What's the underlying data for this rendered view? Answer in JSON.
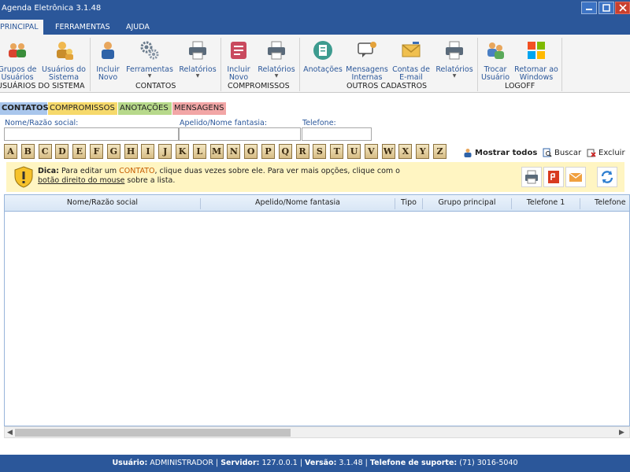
{
  "window": {
    "title": "Agenda Eletrônica 3.1.48"
  },
  "menu": {
    "tabs": [
      "PRINCIPAL",
      "FERRAMENTAS",
      "AJUDA"
    ]
  },
  "ribbon": {
    "sistema": {
      "grupos_l1": "Grupos de",
      "grupos_l2": "Usuários",
      "usuarios_l1": "Usuários do",
      "usuarios_l2": "Sistema",
      "label": "USUÁRIOS DO SISTEMA"
    },
    "contatos": {
      "incluir_l1": "Incluir",
      "incluir_l2": "Novo",
      "ferramentas": "Ferramentas",
      "relatorios": "Relatórios",
      "label": "CONTATOS"
    },
    "compromissos": {
      "incluir_l1": "Incluir",
      "incluir_l2": "Novo",
      "relatorios": "Relatórios",
      "label": "COMPROMISSOS"
    },
    "outros": {
      "anotacoes": "Anotações",
      "mensagens_l1": "Mensagens",
      "mensagens_l2": "Internas",
      "contas_l1": "Contas de",
      "contas_l2": "E-mail",
      "relatorios": "Relatórios",
      "label": "OUTROS CADASTROS"
    },
    "logoff": {
      "trocar_l1": "Trocar",
      "trocar_l2": "Usuário",
      "retornar_l1": "Retornar ao",
      "retornar_l2": "Windows",
      "label": "LOGOFF"
    }
  },
  "subtabs": [
    {
      "label": "CONTATOS",
      "color": "#a9c6ec"
    },
    {
      "label": "COMPROMISSOS",
      "color": "#f6d96b"
    },
    {
      "label": "ANOTAÇÕES",
      "color": "#b7d98b"
    },
    {
      "label": "MENSAGENS",
      "color": "#f2a6a6"
    }
  ],
  "filters": {
    "nome_label": "Nome/Razão social:",
    "nome_value": "",
    "apelido_label": "Apelido/Nome fantasia:",
    "apelido_value": "",
    "telefone_label": "Telefone:",
    "telefone_value": ""
  },
  "letters": [
    "A",
    "B",
    "C",
    "D",
    "E",
    "F",
    "G",
    "H",
    "I",
    "J",
    "K",
    "L",
    "M",
    "N",
    "O",
    "P",
    "Q",
    "R",
    "S",
    "T",
    "U",
    "V",
    "W",
    "X",
    "Y",
    "Z"
  ],
  "actions": {
    "mostrar_todos": "Mostrar todos",
    "buscar": "Buscar",
    "excluir": "Excluir"
  },
  "tip": {
    "dica": "Dica:",
    "part1": " Para editar um ",
    "contato": "CONTATO",
    "part2": ", clique duas vezes sobre ele. Para ver mais opções, clique com o",
    "link": "botão direito do mouse",
    "part3": " sobre a lista."
  },
  "table": {
    "columns": [
      "Nome/Razão social",
      "Apelido/Nome fantasia",
      "Tipo",
      "Grupo principal",
      "Telefone 1",
      "Telefone"
    ]
  },
  "status": {
    "usuario_label": "Usuário:",
    "usuario_value": " ADMINISTRADOR",
    "servidor_label": "Servidor:",
    "servidor_value": " 127.0.0.1",
    "versao_label": "Versão:",
    "versao_value": " 3.1.48",
    "suporte_label": "Telefone de suporte:",
    "suporte_value": " (71) 3016-5040"
  },
  "colors": {
    "brand": "#2b579a",
    "tip_bg": "#fff5c2",
    "accent_orange": "#c65c00"
  }
}
